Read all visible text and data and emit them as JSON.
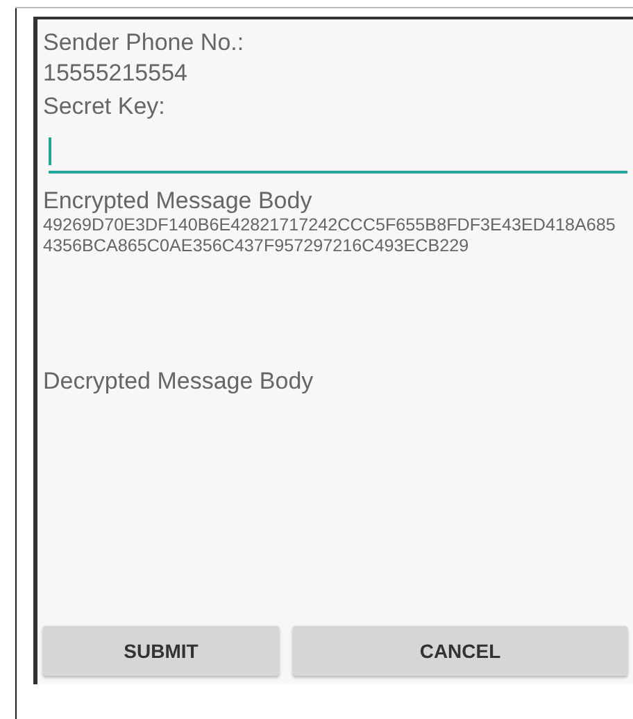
{
  "sender_label": "Sender Phone No.:",
  "sender_phone": "15555215554",
  "secret_key_label": "Secret Key:",
  "secret_key_field": {
    "focused": true
  },
  "encrypted_label": "Encrypted Message Body",
  "encrypted_body": "49269D70E3DF140B6E42821717242CCC5F655B8FDF3E43ED418A6854356BCA865C0AE356C437F957297216C493ECB229",
  "decrypted_label": "Decrypted Message Body",
  "buttons": [
    "SUBMIT",
    "CANCEL"
  ]
}
